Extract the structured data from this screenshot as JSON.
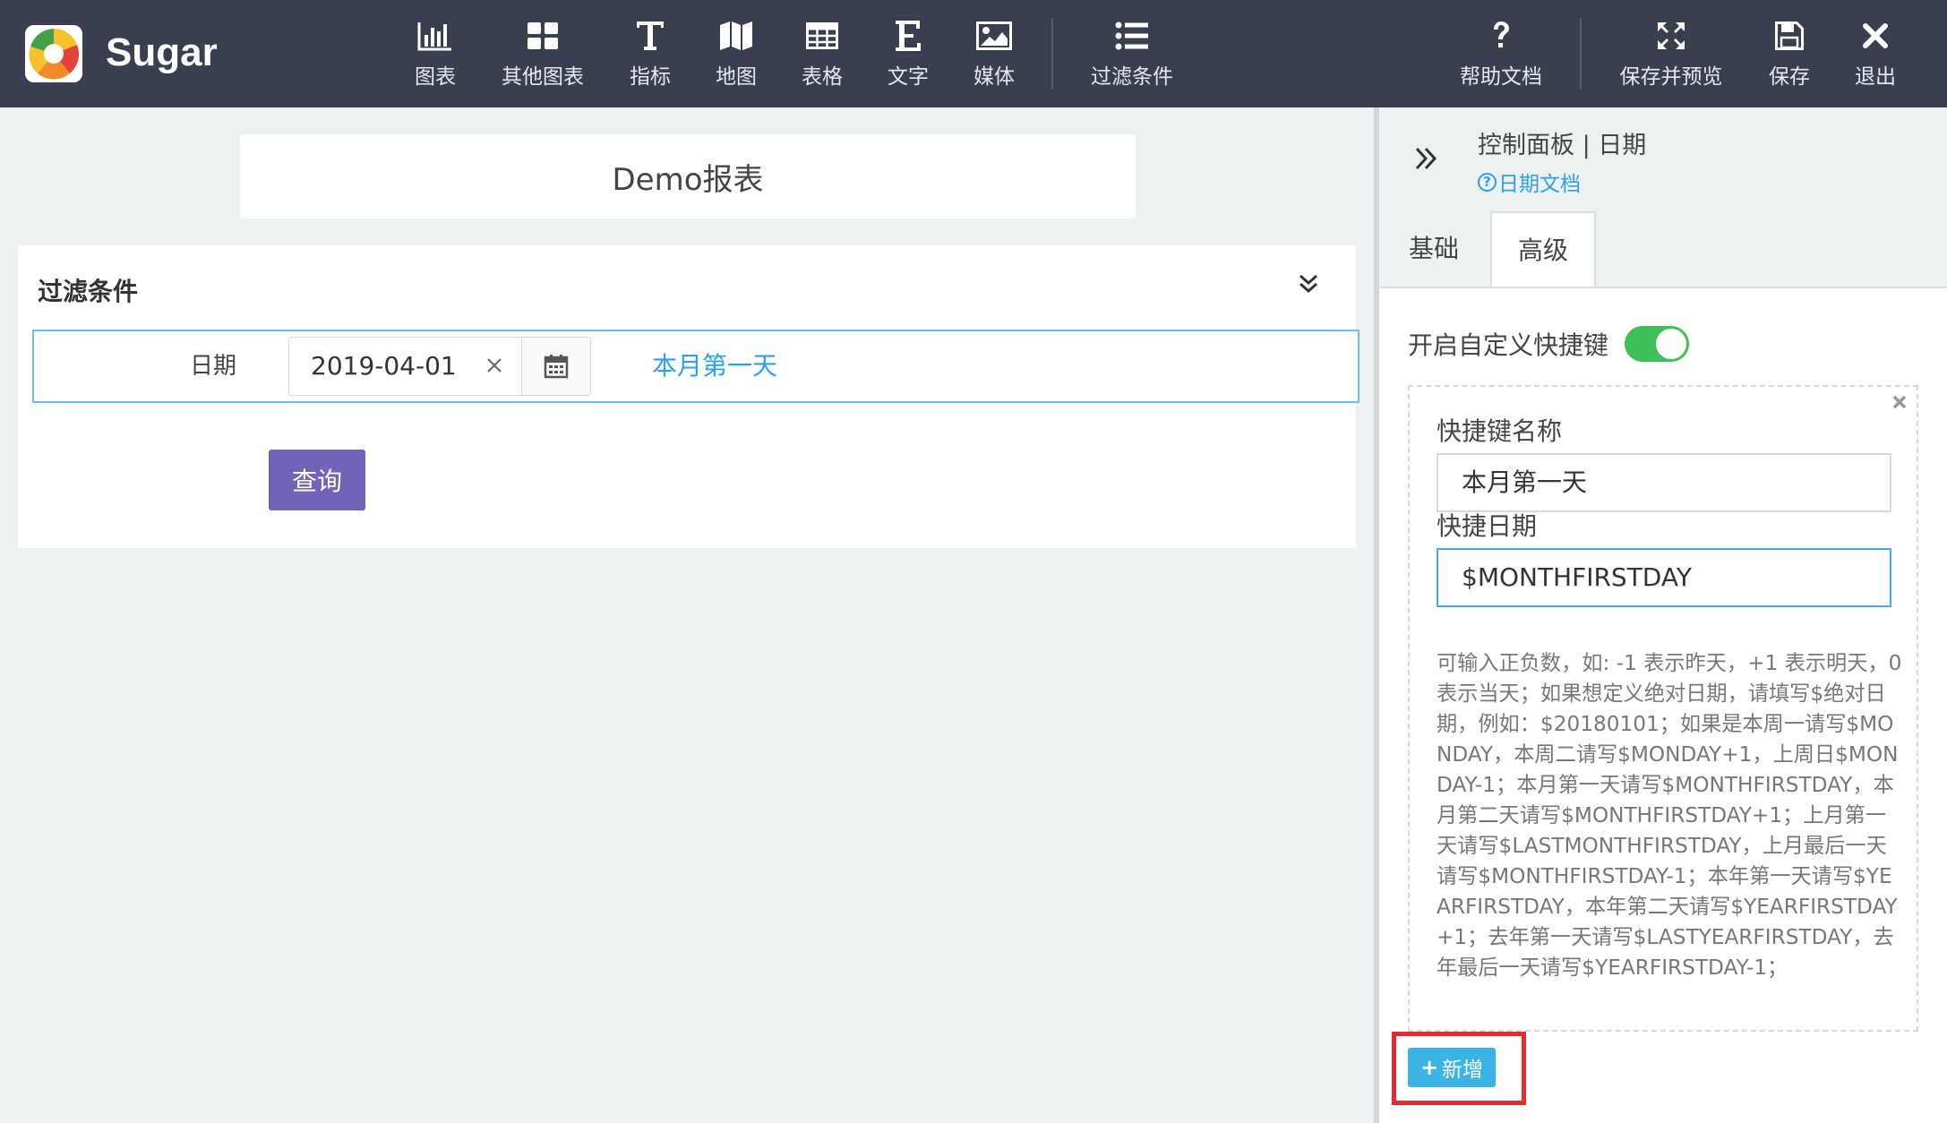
{
  "app": {
    "name": "Sugar"
  },
  "toolbar": {
    "items": [
      {
        "label": "图表",
        "icon": "bar-chart-icon"
      },
      {
        "label": "其他图表",
        "icon": "grid-icon"
      },
      {
        "label": "指标",
        "icon": "text-t-icon"
      },
      {
        "label": "地图",
        "icon": "map-icon"
      },
      {
        "label": "表格",
        "icon": "table-icon"
      },
      {
        "label": "文字",
        "icon": "text-e-icon"
      },
      {
        "label": "媒体",
        "icon": "image-icon"
      },
      {
        "label": "过滤条件",
        "icon": "list-icon"
      }
    ],
    "right_items": [
      {
        "label": "帮助文档",
        "icon": "question-icon"
      },
      {
        "label": "保存并预览",
        "icon": "expand-icon"
      },
      {
        "label": "保存",
        "icon": "save-icon"
      },
      {
        "label": "退出",
        "icon": "close-icon"
      }
    ]
  },
  "report": {
    "title": "Demo报表"
  },
  "filter": {
    "title": "过滤条件",
    "date_label": "日期",
    "date_value": "2019-04-01",
    "clear_symbol": "×",
    "shortcut_link": "本月第一天",
    "query_label": "查询"
  },
  "panel": {
    "title": "控制面板 | 日期",
    "doc_link": "日期文档",
    "doc_icon_symbol": "?",
    "tabs": [
      "基础",
      "高级"
    ],
    "active_tab": "高级",
    "toggle_label": "开启自定义快捷键",
    "toggle_on": true,
    "shortcut": {
      "name_label": "快捷键名称",
      "name_value": "本月第一天",
      "date_label": "快捷日期",
      "date_value": "$MONTHFIRSTDAY",
      "help": "可输入正负数，如: -1 表示昨天，+1 表示明天，0表示当天；如果想定义绝对日期，请填写$绝对日期，例如：$20180101；如果是本周一请写$MONDAY，本周二请写$MONDAY+1，上周日$MONDAY-1；本月第一天请写$MONTHFIRSTDAY，本月第二天请写$MONTHFIRSTDAY+1；上月第一天请写$LASTMONTHFIRSTDAY，上月最后一天请写$MONTHFIRSTDAY-1；本年第一天请写$YEARFIRSTDAY，本年第二天请写$YEARFIRSTDAY+1；去年第一天请写$LASTYEARFIRSTDAY，去年最后一天请写$YEARFIRSTDAY-1；"
    },
    "add_label": "新增",
    "add_symbol": "+"
  },
  "colors": {
    "topbar": "#3a3f4f",
    "accent_link": "#2c9ff5",
    "query_button": "#7163b8",
    "toggle_on": "#3fbf5a",
    "add_button": "#3cb3e6",
    "highlight": "#e02e2e"
  }
}
